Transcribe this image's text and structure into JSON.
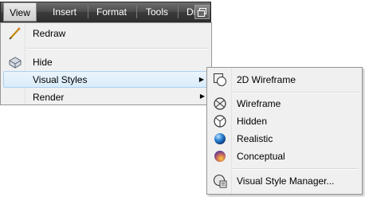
{
  "menubar": {
    "items": [
      {
        "label": "View"
      },
      {
        "label": "Insert"
      },
      {
        "label": "Format"
      },
      {
        "label": "Tools"
      },
      {
        "label": "Draw"
      }
    ]
  },
  "view_menu": {
    "items": [
      {
        "label": "Redraw",
        "icon": "pencil-icon"
      },
      {
        "label": "Hide",
        "icon": "hide-icon"
      },
      {
        "label": "Visual Styles",
        "icon": "",
        "submenu": true
      },
      {
        "label": "Render",
        "icon": "",
        "submenu": true
      }
    ]
  },
  "visual_styles_submenu": {
    "items": [
      {
        "label": "2D Wireframe",
        "icon": "2d-wireframe-icon"
      },
      {
        "label": "Wireframe",
        "icon": "wireframe-icon"
      },
      {
        "label": "Hidden",
        "icon": "hidden-icon"
      },
      {
        "label": "Realistic",
        "icon": "realistic-sphere-icon"
      },
      {
        "label": "Conceptual",
        "icon": "conceptual-sphere-icon"
      },
      {
        "label": "Visual Style Manager...",
        "icon": "visual-style-manager-icon"
      }
    ]
  },
  "colors": {
    "menubar_bg": "#3b3b3b",
    "highlight": "#d9ecfa",
    "menu_bg": "#f0f0f0"
  }
}
